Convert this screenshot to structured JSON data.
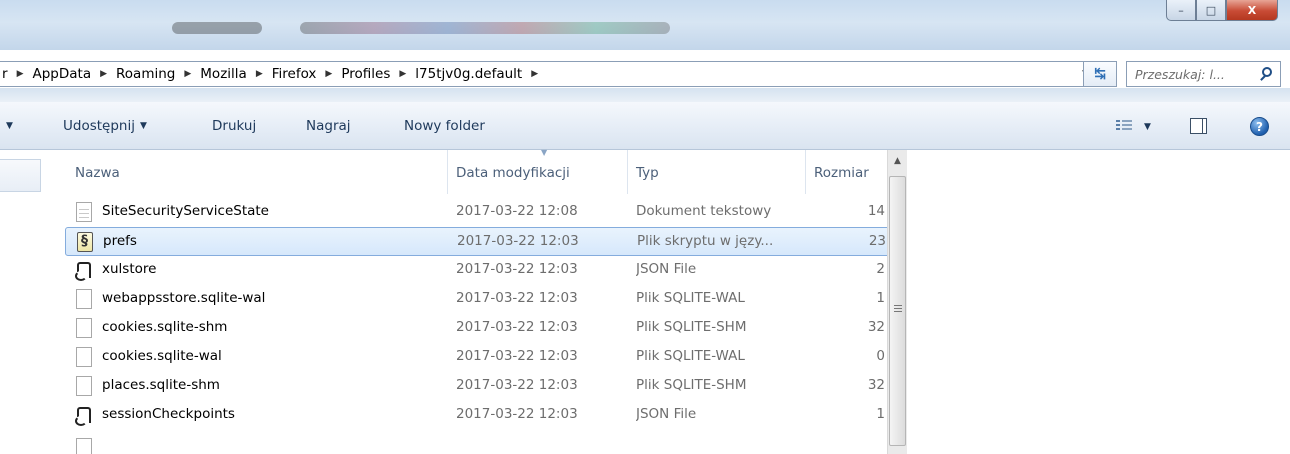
{
  "window": {
    "buttons": [
      "–",
      "□",
      "X"
    ]
  },
  "address": {
    "crumbs": [
      "r",
      "AppData",
      "Roaming",
      "Mozilla",
      "Firefox",
      "Profiles",
      "l75tjv0g.default"
    ],
    "search_placeholder": "Przeszukaj: l..."
  },
  "commandbar": {
    "share": "Udostępnij",
    "print": "Drukuj",
    "burn": "Nagraj",
    "new_folder": "Nowy folder"
  },
  "columns": {
    "name": "Nazwa",
    "date": "Data modyfikacji",
    "type": "Typ",
    "size": "Rozmiar"
  },
  "files": [
    {
      "name": "SiteSecurityServiceState",
      "date": "2017-03-22 12:08",
      "type": "Dokument tekstowy",
      "size": "14",
      "icon": "text-document-icon"
    },
    {
      "name": "prefs",
      "date": "2017-03-22 12:03",
      "type": "Plik skryptu w języ...",
      "size": "23",
      "icon": "script-file-icon"
    },
    {
      "name": "xulstore",
      "date": "2017-03-22 12:03",
      "type": "JSON File",
      "size": "2",
      "icon": "json-file-icon"
    },
    {
      "name": "webappsstore.sqlite-wal",
      "date": "2017-03-22 12:03",
      "type": "Plik SQLITE-WAL",
      "size": "1",
      "icon": "blank-file-icon"
    },
    {
      "name": "cookies.sqlite-shm",
      "date": "2017-03-22 12:03",
      "type": "Plik SQLITE-SHM",
      "size": "32",
      "icon": "blank-file-icon"
    },
    {
      "name": "cookies.sqlite-wal",
      "date": "2017-03-22 12:03",
      "type": "Plik SQLITE-WAL",
      "size": "0",
      "icon": "blank-file-icon"
    },
    {
      "name": "places.sqlite-shm",
      "date": "2017-03-22 12:03",
      "type": "Plik SQLITE-SHM",
      "size": "32",
      "icon": "blank-file-icon"
    },
    {
      "name": "sessionCheckpoints",
      "date": "2017-03-22 12:03",
      "type": "JSON File",
      "size": "1",
      "icon": "json-file-icon"
    }
  ],
  "selected_file": "prefs",
  "colors": {
    "selection_bg": "#d6e8fb",
    "selection_border": "#84acdd",
    "header_text": "#4c607a",
    "close_button": "#c84b35"
  }
}
